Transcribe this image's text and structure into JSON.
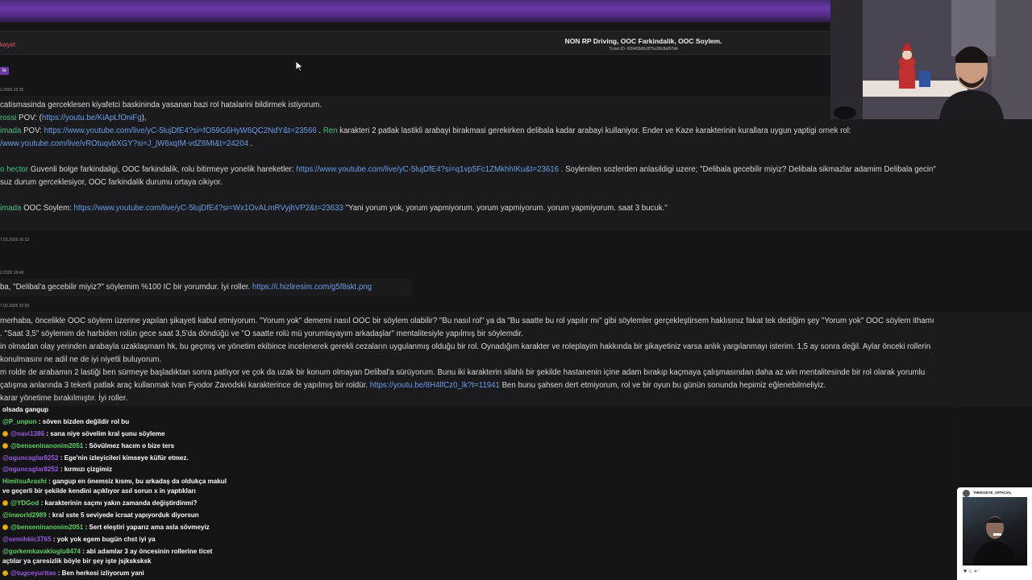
{
  "ticket": {
    "status_label": "kayet",
    "title": "NON RP Driving, OOC Farkindalik, OOC Soylem.",
    "ticket_id": "Ticket ID: 699469d6c0f7bc00c8af67d4",
    "tag_label": "le"
  },
  "timestamps": {
    "t1": "2.2026 16:15",
    "t2": "7.02.2026 16:22",
    "t3": "2.2026 18:49",
    "t4": "7.02.2026 20:09"
  },
  "complaint": {
    "l1": "catismasinda gerceklesen kiyafetci baskininda yasanan bazi rol hatalarini bildirmek istiyorum.",
    "l2_a": "rossi",
    "l2_b": " POV: (",
    "l2_link": "https://youtu.be/KiApLfOniFg",
    "l2_c": "),",
    "l3_a": "imada",
    "l3_b": " POV: ",
    "l3_link": "https://www.youtube.com/live/yC-5lujDfE4?si=fO59G6HyW6QC2NdY&t=23566",
    "l3_c": " . ",
    "l3_men": "Ren",
    "l3_d": " karakteri 2 patlak lastikli arabayi birakmasi gerekirken delibala kadar arabayi kullaniyor.  Ender ve Kaze karakterinin kurallara uygun yaptigi ornek rol:",
    "l4_link": "/www.youtube.com/live/vROtuqvbXGY?si=J_jW6xqIM-vdZ6MI&t=24204",
    "l4_b": " .",
    "l5_a": "o hector",
    "l5_b": " Guvenli bolge farkindaligi, OOC farkindalik, rolu bitirmeye yonelik hareketler: ",
    "l5_link": "https://www.youtube.com/live/yC-5lujDfE4?si=q1vp5Fc1ZMkhhIKu&t=23616",
    "l5_c": " . Soylenilen sozlerden anlasildigi uzere; \"Delibala gecebilir miyiz? Delibala sikmazlar adamim Delibala gecin\"",
    "l6": "suz durum gerceklesiyor, OOC farkindalik durumu ortaya cikiyor.",
    "l7_a": "imada",
    "l7_b": " OOC Soylem: ",
    "l7_link": "https://www.youtube.com/live/yC-5lujDfE4?si=Wx1OvALmRVyjhVP2&t=23633",
    "l7_c": " \"Yani yorum yok, yorum yapmiyorum. yorum yapmiyorum. yorum yapmiyorum. saat 3 bucuk.\""
  },
  "reply1": {
    "text": "ba, \"Delibal'a gecebilir miyiz?\" söylemim %100 IC bir yorumdur. İyi roller. ",
    "link": "https://i.hizliresim.com/g5f8skt.png"
  },
  "reply2": {
    "l1": "merhaba, öncelikle OOC söylem üzerine yapılan şikayeti kabul etmiyorum. \"Yorum yok\" dememi nasıl OOC bir söylem olabilir? \"Bu nasıl rol\" ya da \"Bu saatte bu rol yapılır mı\" gibi söylemler gerçekleştirsem haklısınız fakat tek dediğim şey \"Yorum yok\" OOC söylem ithamı",
    "l2": ". \"Saat 3,5\" söylemim de harbiden rolün gece saat 3,5'da döndüğü ve \"O saatte rolü mü yorumlayayım arkadaşlar\" mentalitesiyle yapılmış bir söylemdir.",
    "l3": "in olmadan olay yerinden arabayla uzaklaşmam hk, bu geçmiş ve yönetim ekibince incelenerek gerekli cezaların uygulanmış olduğu bir rol. Oynadığım karakter ve roleplayim hakkında bir şikayetiniz varsa anlık yargılanmayı isterim. 1,5 ay sonra değil. Aylar önceki rollerin",
    "l4": "konulmasını ne adil ne de iyi niyetli buluyorum.",
    "l5": "m rolde de arabamın 2 lastiği ben sürmeye başladıktan sonra patlıyor ve çok da uzak bir konum olmayan Delibal'a sürüyorum. Bunu iki karakterin silahlı bir şekilde hastanenin içine adam bırakıp kaçmaya çalışmasından daha az win mentalitesinde bir rol olarak yorumlu",
    "l6_a": "çatışma anlarında 3 tekerli patlak araç kullanmak Ivan Fyodor Zavodski karakterince de yapılmış bir roldür. ",
    "l6_link": "https://youtu.be/8H4lfCz0_lk?t=11941",
    "l6_b": " Ben bunu şahsen dert etmiyorum, rol ve bir oyun bu günün sonunda hepimiz eğlenebilmeliyiz.",
    "l7": "karar yönetime bırakılmıştır. İyi roller."
  },
  "chat": [
    {
      "badge": false,
      "user": "",
      "text": "olsada gangup",
      "color": ""
    },
    {
      "badge": false,
      "user": "@P_unpun",
      "text": " : söven bizden değildir rol bu",
      "color": "green"
    },
    {
      "badge": true,
      "user": "@navi1386",
      "text": " : sana niye sövelim kral şunu söyleme",
      "color": "purple"
    },
    {
      "badge": true,
      "user": "@benseninanonim2051",
      "text": " : Sövülmez hacım o bize ters",
      "color": "green"
    },
    {
      "badge": false,
      "user": "@oguncaglar8252",
      "text": " : Ege'nin izleyicileri kimseye küfür etmez.",
      "color": "purple"
    },
    {
      "badge": false,
      "user": "@oguncaglar8252",
      "text": " : kırmızı çizgimiz",
      "color": "purple"
    },
    {
      "badge": false,
      "user": "HimitsuArashi",
      "text": " : gangup en önemsiz kısmı, bu arkadaş da oldukça makul",
      "color": "green"
    },
    {
      "badge": false,
      "user": "",
      "text": "ve geçerli bir şekilde kendini açıklıyor asıl sorun x in yaptıkları",
      "color": ""
    },
    {
      "badge": true,
      "user": "@YDGod",
      "text": " : karakterinin saçmı yakın zamanda değiştirdinmi?",
      "color": "green"
    },
    {
      "badge": false,
      "user": "@inworld2989",
      "text": " : kral sste 5 seviyede icraat yapıyorduk diyorsun",
      "color": "green"
    },
    {
      "badge": true,
      "user": "@benseninanonim2051",
      "text": " : Sert eleştiri yaparız ama asla sövmeyiz",
      "color": "green"
    },
    {
      "badge": false,
      "user": "@semihklc3765",
      "text": " : yok yok egem bugün chst iyi ya",
      "color": "purple"
    },
    {
      "badge": false,
      "user": "@gorkemkavakloglu8474",
      "text": " : abi adamlar 3 ay öncesinin rollerine ticet",
      "color": "green"
    },
    {
      "badge": false,
      "user": "",
      "text": "açtılar ya çaresizlik böyle bir şey işte jsjksksksk",
      "color": ""
    },
    {
      "badge": true,
      "user": "@tugceyurttas",
      "text": " : Ben herkesi izliyorum yani",
      "color": "purple"
    }
  ],
  "overlay": {
    "handle": "THEEGEYE_OFFICIAL",
    "icons": "♥ ○ ➢"
  }
}
